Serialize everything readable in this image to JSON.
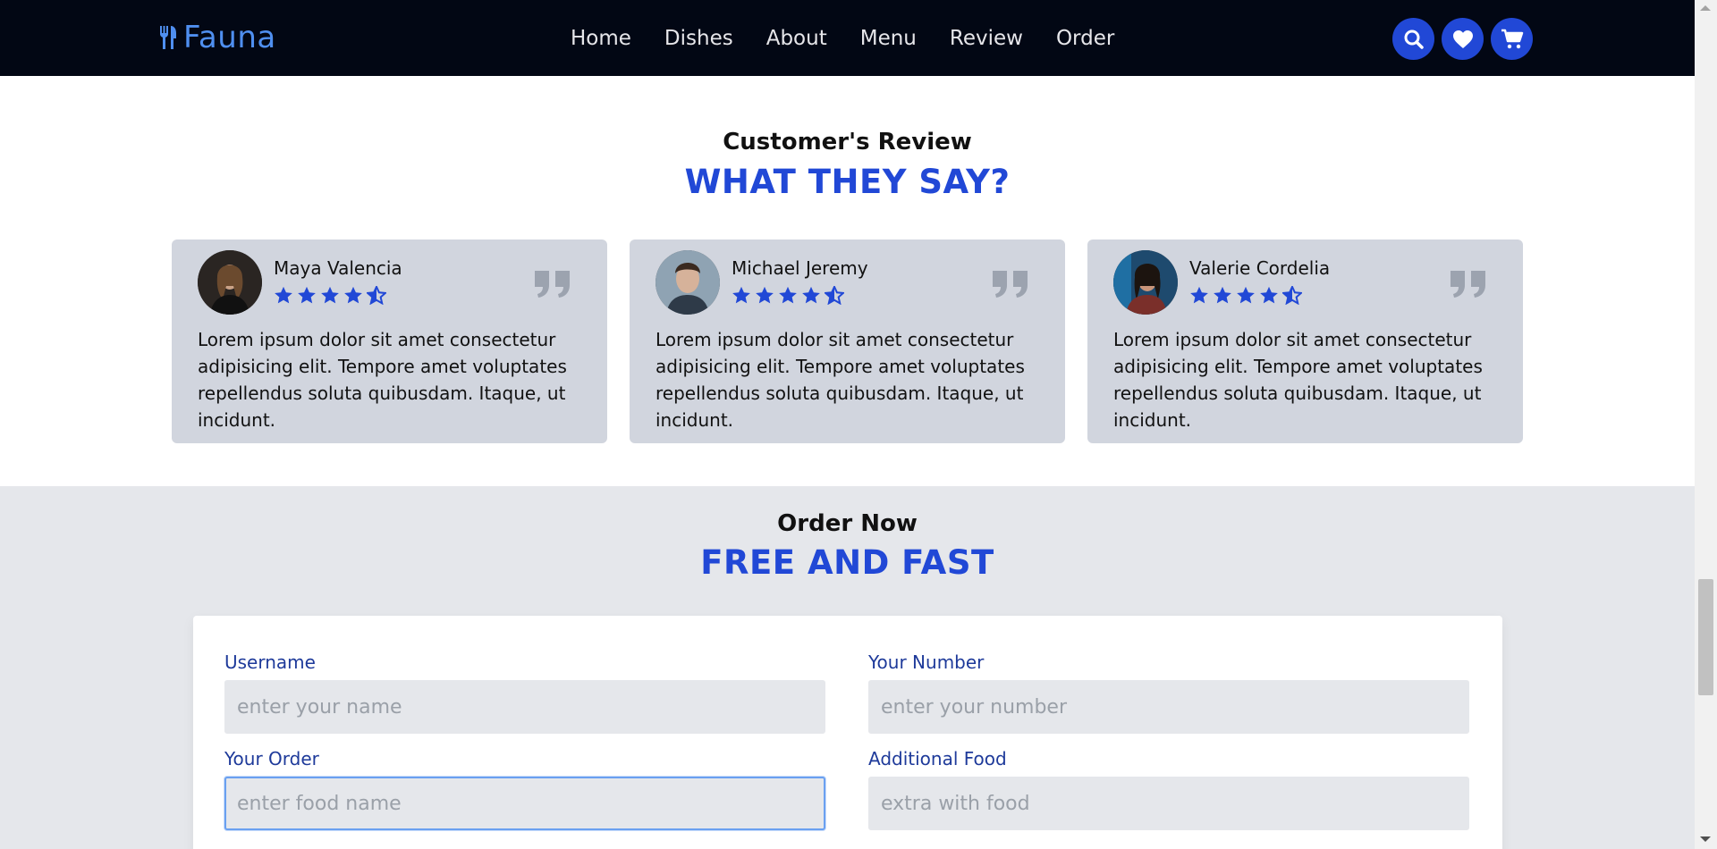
{
  "brand": {
    "name": "Fauna",
    "color": "#4f8ff0"
  },
  "nav": {
    "items": [
      "Home",
      "Dishes",
      "About",
      "Menu",
      "Review",
      "Order"
    ]
  },
  "header_icons": [
    "search-icon",
    "heart-icon",
    "cart-icon"
  ],
  "accent_color": "#2148d6",
  "review": {
    "subtitle": "Customer's Review",
    "title": "WHAT THEY SAY?",
    "cards": [
      {
        "name": "Maya Valencia",
        "rating": 4.5,
        "text": "Lorem ipsum dolor sit amet consectetur adipisicing elit. Tempore amet voluptates repellendus soluta quibusdam. Itaque, ut incidunt."
      },
      {
        "name": "Michael Jeremy",
        "rating": 4.5,
        "text": "Lorem ipsum dolor sit amet consectetur adipisicing elit. Tempore amet voluptates repellendus soluta quibusdam. Itaque, ut incidunt."
      },
      {
        "name": "Valerie Cordelia",
        "rating": 4.5,
        "text": "Lorem ipsum dolor sit amet consectetur adipisicing elit. Tempore amet voluptates repellendus soluta quibusdam. Itaque, ut incidunt."
      }
    ]
  },
  "order": {
    "subtitle": "Order Now",
    "title": "FREE AND FAST",
    "fields": {
      "username": {
        "label": "Username",
        "placeholder": "enter your name",
        "value": ""
      },
      "number": {
        "label": "Your Number",
        "placeholder": "enter your number",
        "value": ""
      },
      "order": {
        "label": "Your Order",
        "placeholder": "enter food name",
        "value": ""
      },
      "additional": {
        "label": "Additional Food",
        "placeholder": "extra with food",
        "value": ""
      }
    }
  }
}
